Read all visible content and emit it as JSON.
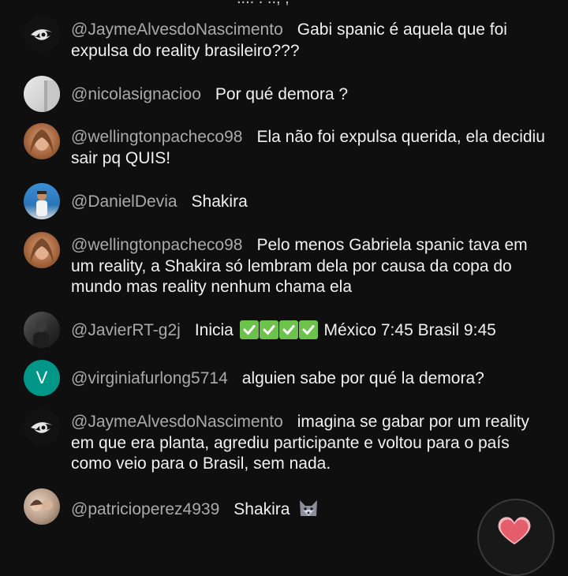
{
  "chat": {
    "messages": [
      {
        "author": "@JaymeAlvesdoNascimento",
        "text": "Gabi spanic é aquela que foi expulsa do reality brasileiro???",
        "avatar": "eye-avatar"
      },
      {
        "author": "@nicolasignacioo",
        "text": "Por qué demora ?",
        "avatar": "photo-avatar"
      },
      {
        "author": "@wellingtonpacheco98",
        "text": "Ela não foi expulsa querida, ela decidiu sair pq QUIS!",
        "avatar": "photo-avatar"
      },
      {
        "author": "@DanielDevia",
        "text": "Shakira",
        "avatar": "photo-avatar"
      },
      {
        "author": "@wellingtonpacheco98",
        "text": "Pelo menos Gabriela spanic tava em um reality, a Shakira só lembram dela por causa da copa do mundo mas reality nenhum chama ela",
        "avatar": "photo-avatar"
      },
      {
        "author": "@JavierRT-g2j",
        "text_before": "Inicia",
        "emoji": "✅",
        "emoji_count": 4,
        "text_after": "México 7:45 Brasil 9:45",
        "avatar": "photo-avatar"
      },
      {
        "author": "@virginiafurlong5714",
        "text": "alguien sabe por qué la demora?",
        "avatar_letter": "V",
        "avatar": "letter-avatar"
      },
      {
        "author": "@JaymeAlvesdoNascimento",
        "text": "imagina se gabar por um reality em que era planta, agrediu participante e voltou para o país como veio para o Brasil, sem nada.",
        "avatar": "eye-avatar"
      },
      {
        "author": "@patricioperez4939",
        "text": "Shakira",
        "emoji": "🐺",
        "avatar": "photo-avatar"
      }
    ],
    "colors": {
      "background": "#0f0f0f",
      "author": "#aaaaaa",
      "text": "#f1f1f1",
      "letter_avatar": "#009688",
      "heart": "#e35d6a",
      "check": "#6cc24a"
    }
  },
  "fab": {
    "icon": "heart-icon"
  }
}
